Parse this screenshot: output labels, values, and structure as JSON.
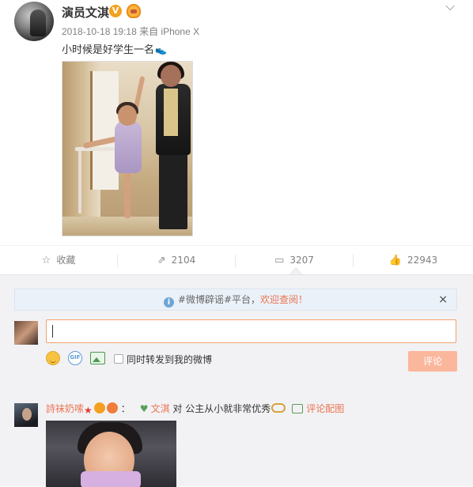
{
  "post": {
    "author": "演员文淇",
    "verified_badge": "V",
    "meta": "2018-10-18 19:18 来自 iPhone X",
    "text": "小时候是好学生一名",
    "text_emoji": "👟",
    "more_icon": "chevron-down-icon"
  },
  "actions": {
    "favorite_label": "收藏",
    "repost_count": "2104",
    "comment_count": "3207",
    "like_count": "22943"
  },
  "notice": {
    "prefix": "#微博辟谣#平台，",
    "link": "欢迎查阅！",
    "info_icon": "i",
    "close": "×"
  },
  "composer": {
    "input_value": "",
    "gif_label": "GIF",
    "repost_checkbox_label": "同时转发到我的微博",
    "submit_label": "评论",
    "checkbox_checked": false
  },
  "comment": {
    "user": "詩袜奶嗦",
    "colon": "：",
    "reply_to": "文淇",
    "text": "对 公主从小就非常优秀",
    "view_pic_label": "评论配图"
  },
  "colors": {
    "accent": "#eb7350",
    "submit_disabled": "#fbb79c",
    "comment_bg": "#f2f2f5"
  }
}
